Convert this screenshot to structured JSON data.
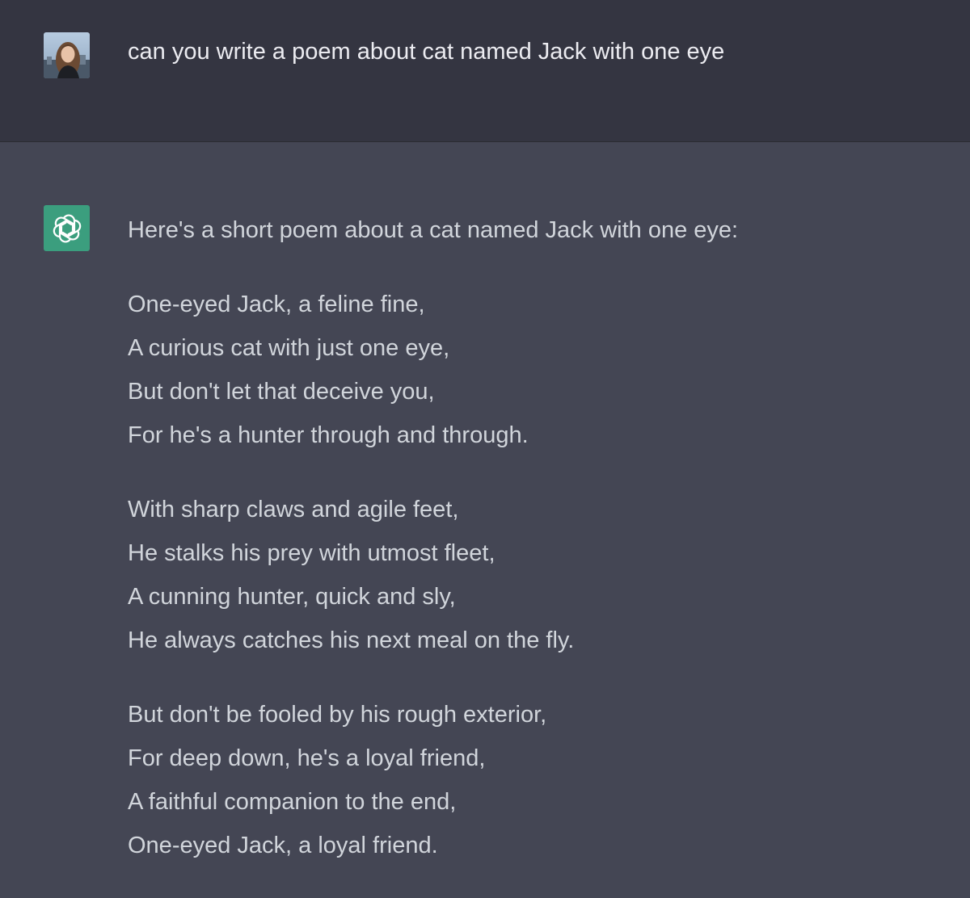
{
  "conversation": {
    "user_message": "can you write a poem about cat named Jack with one eye",
    "assistant_intro": "Here's a short poem about a cat named Jack with one eye:",
    "stanzas": [
      {
        "lines": [
          "One-eyed Jack, a feline fine,",
          "A curious cat with just one eye,",
          "But don't let that deceive you,",
          "For he's a hunter through and through."
        ]
      },
      {
        "lines": [
          "With sharp claws and agile feet,",
          "He stalks his prey with utmost fleet,",
          "A cunning hunter, quick and sly,",
          "He always catches his next meal on the fly."
        ]
      },
      {
        "lines": [
          "But don't be fooled by his rough exterior,",
          "For deep down, he's a loyal friend,",
          "A faithful companion to the end,",
          "One-eyed Jack, a loyal friend."
        ]
      }
    ]
  },
  "icons": {
    "user_avatar": "user-avatar-photo",
    "assistant_avatar": "openai-logo-icon"
  },
  "colors": {
    "user_bg": "#343541",
    "assistant_bg": "#444654",
    "assistant_avatar_bg": "#3b9e7e"
  }
}
